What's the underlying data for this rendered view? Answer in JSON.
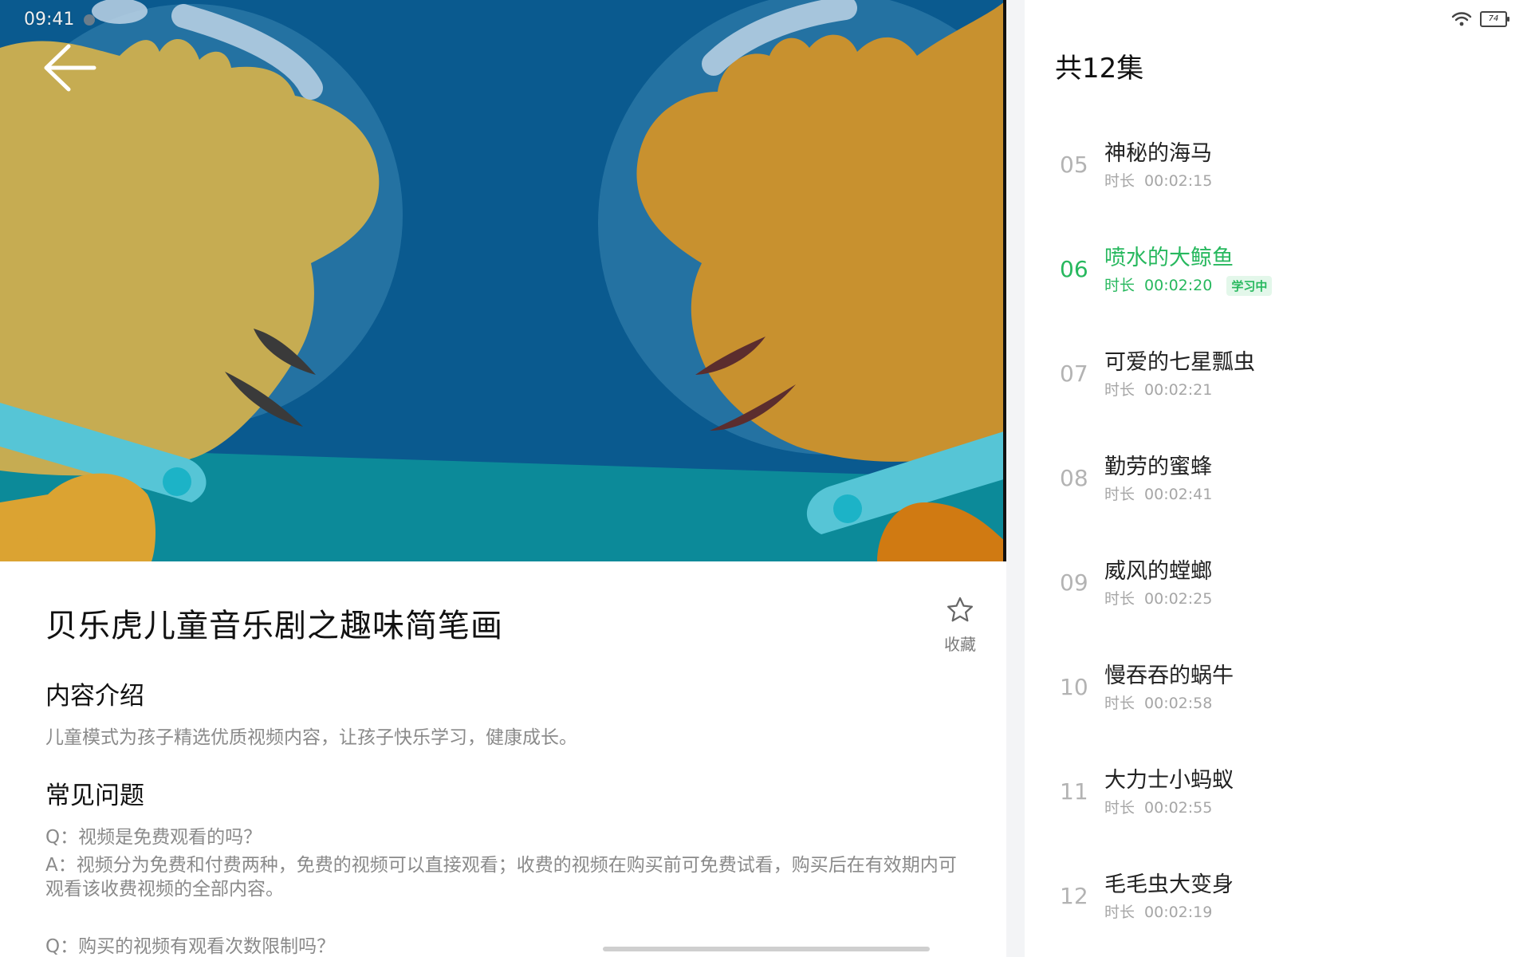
{
  "status": {
    "time": "09:41",
    "battery": "74"
  },
  "video": {
    "back_label": "back"
  },
  "details": {
    "title": "贝乐虎儿童音乐剧之趣味简笔画",
    "favorite_label": "收藏",
    "intro_heading": "内容介绍",
    "intro_text": "儿童模式为孩子精选优质视频内容，让孩子快乐学习，健康成长。",
    "faq_heading": "常见问题",
    "faq": [
      {
        "q": "Q：视频是免费观看的吗？",
        "a": "A：视频分为免费和付费两种，免费的视频可以直接观看；收费的视频在购买前可免费试看，购买后在有效期内可观看该收费视频的全部内容。"
      },
      {
        "q": "Q：购买的视频有观看次数限制吗？",
        "a": ""
      }
    ]
  },
  "episodes": {
    "header": "共12集",
    "duration_label": "时长",
    "items": [
      {
        "num": "05",
        "title": "神秘的海马",
        "duration": "00:02:15",
        "badge": ""
      },
      {
        "num": "06",
        "title": "喷水的大鲸鱼",
        "duration": "00:02:20",
        "badge": "学习中"
      },
      {
        "num": "07",
        "title": "可爱的七星瓢虫",
        "duration": "00:02:21",
        "badge": ""
      },
      {
        "num": "08",
        "title": "勤劳的蜜蜂",
        "duration": "00:02:41",
        "badge": ""
      },
      {
        "num": "09",
        "title": "威风的螳螂",
        "duration": "00:02:25",
        "badge": ""
      },
      {
        "num": "10",
        "title": "慢吞吞的蜗牛",
        "duration": "00:02:58",
        "badge": ""
      },
      {
        "num": "11",
        "title": "大力士小蚂蚁",
        "duration": "00:02:55",
        "badge": ""
      },
      {
        "num": "12",
        "title": "毛毛虫大变身",
        "duration": "00:02:19",
        "badge": ""
      }
    ]
  },
  "colors": {
    "accent": "#27b85e",
    "video_bg": "#0a5a8f"
  }
}
